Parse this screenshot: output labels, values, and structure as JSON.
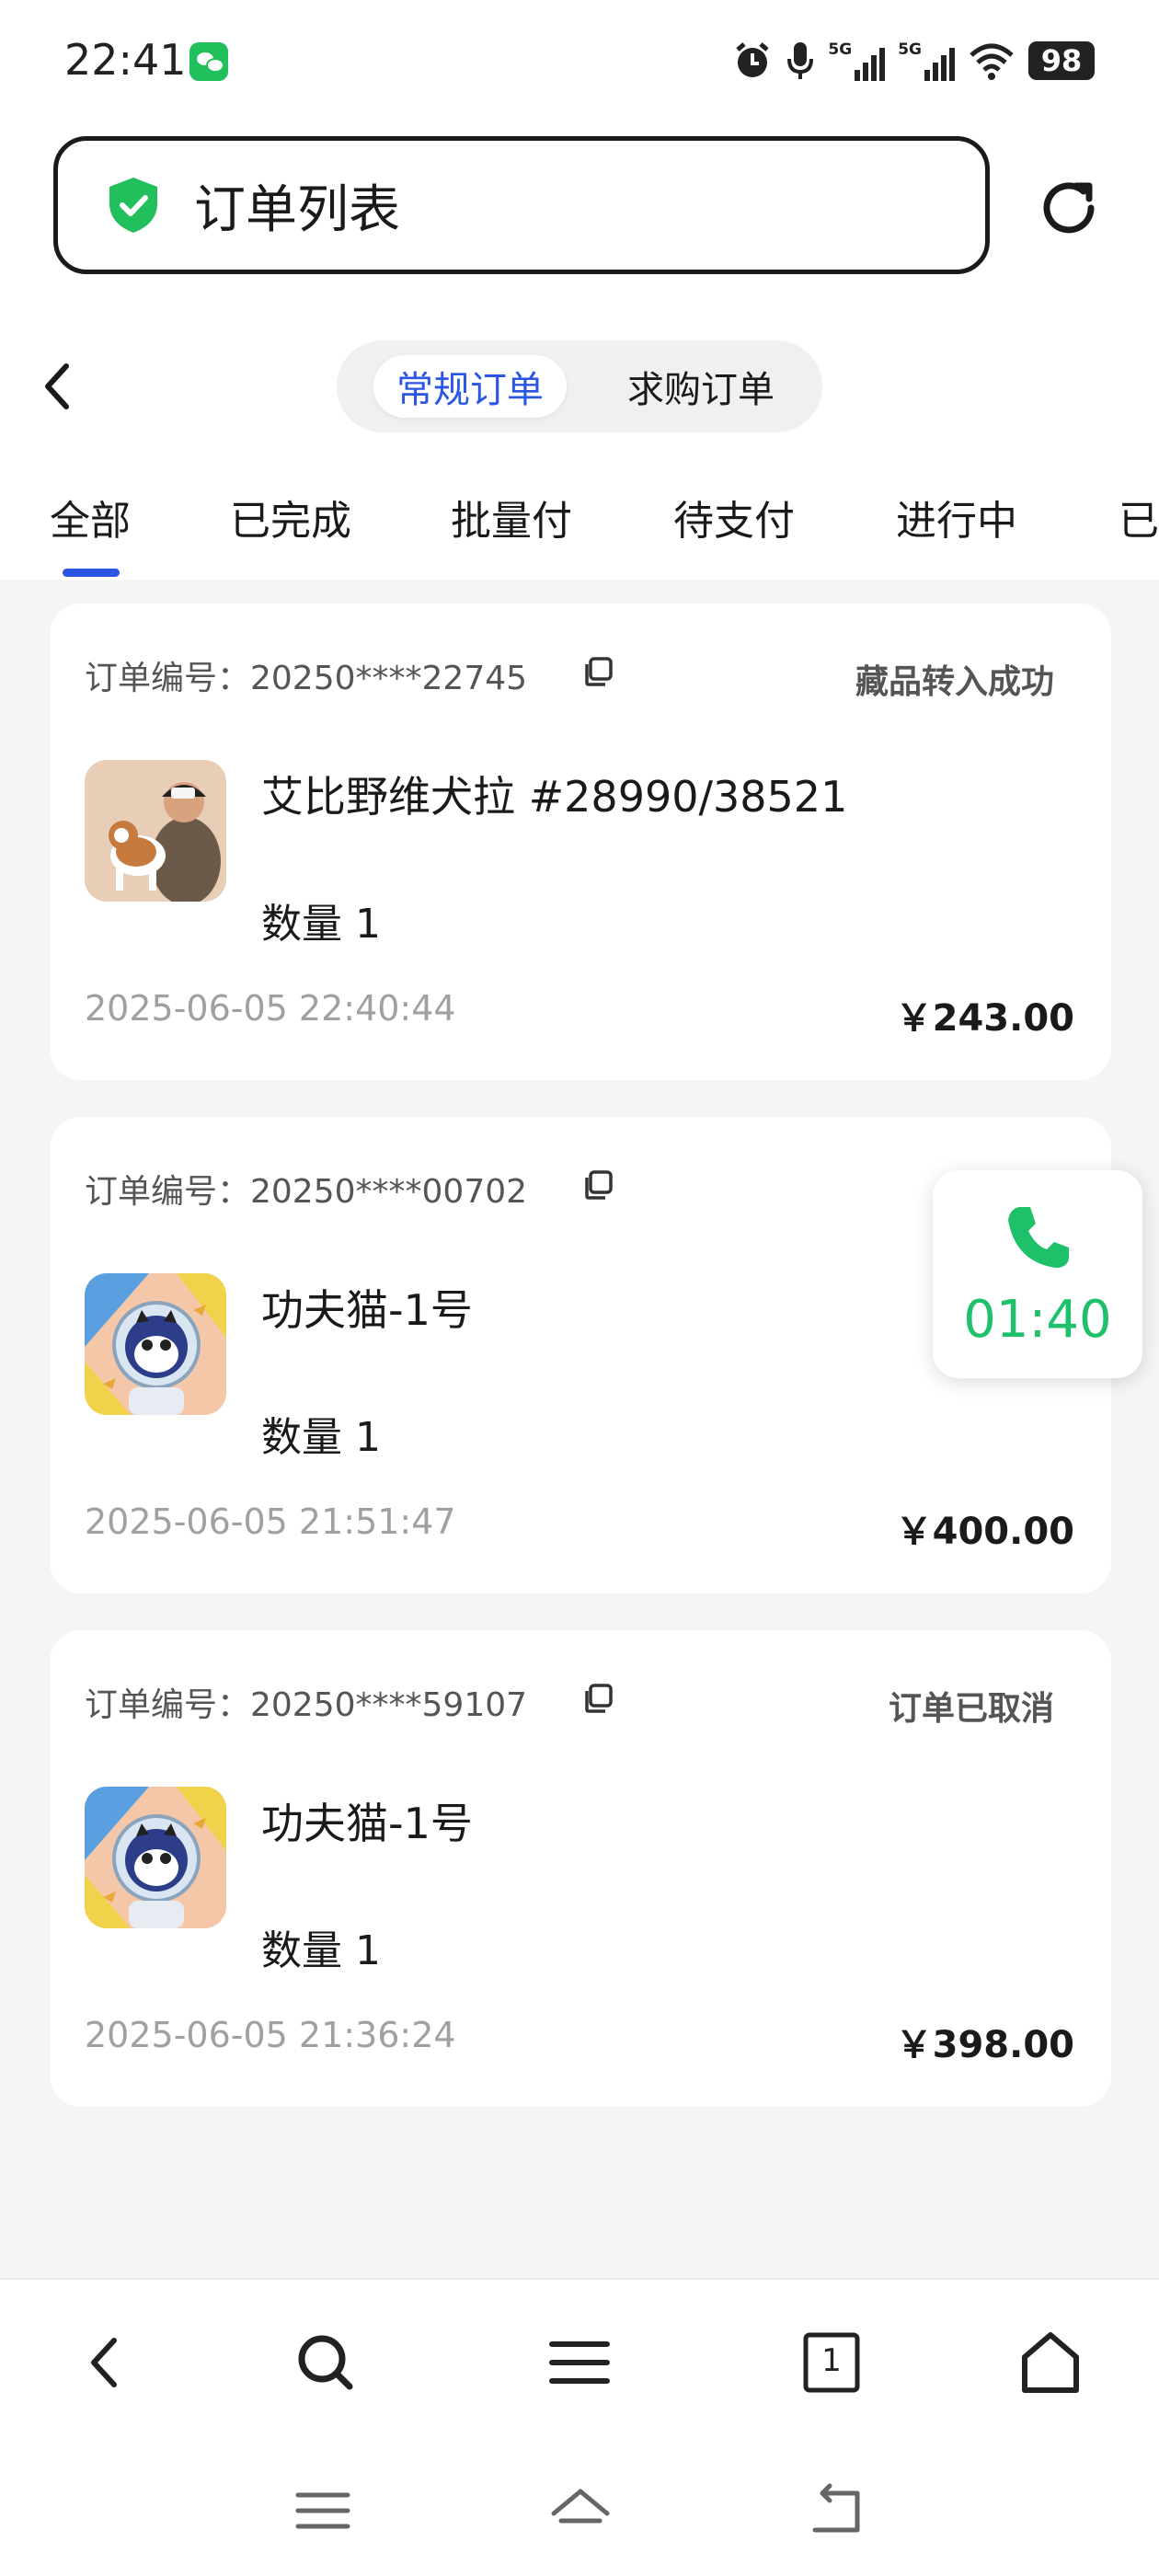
{
  "status_bar": {
    "time": "22:41",
    "network_1": "5G",
    "network_2": "5G",
    "battery": "98",
    "icons": [
      "wechat-icon",
      "alarm-icon",
      "mic-icon",
      "signal-icon",
      "signal-icon",
      "wifi-icon",
      "battery-icon"
    ]
  },
  "header": {
    "title": "订单列表",
    "icons": [
      "shield-check-icon",
      "refresh-icon",
      "back-icon"
    ]
  },
  "segment": {
    "active": "常规订单",
    "inactive": "求购订单"
  },
  "filter_tabs": {
    "selected": 0,
    "items": [
      "全部",
      "已完成",
      "批量付",
      "待支付",
      "进行中",
      "已"
    ]
  },
  "orders": [
    {
      "label": "订单编号：20250****22745",
      "status": "藏品转入成功",
      "name": "艾比野维犬拉  #28990/38521",
      "quantity": "数量 1",
      "time": "2025-06-05 22:40:44",
      "price": "￥243.00"
    },
    {
      "label": "订单编号：20250****00702",
      "status": "",
      "name": "功夫猫-1号",
      "quantity": "数量 1",
      "time": "2025-06-05 21:51:47",
      "price": "￥400.00"
    },
    {
      "label": "订单编号：20250****59107",
      "status": "订单已取消",
      "name": "功夫猫-1号",
      "quantity": "数量 1",
      "time": "2025-06-05 21:36:24",
      "price": "￥398.00"
    }
  ],
  "call": {
    "timer": "01:40"
  },
  "browser_bar": {
    "tab_count": "1",
    "icons": [
      "back-icon",
      "search-icon",
      "menu-icon",
      "tabs-icon",
      "home-icon"
    ]
  },
  "system_nav": {
    "icons": [
      "recent-apps-icon",
      "home-icon",
      "back-icon"
    ]
  },
  "colors": {
    "accent": "#2a55e5",
    "call_green": "#1ec06a",
    "shield_green": "#22c05d"
  }
}
